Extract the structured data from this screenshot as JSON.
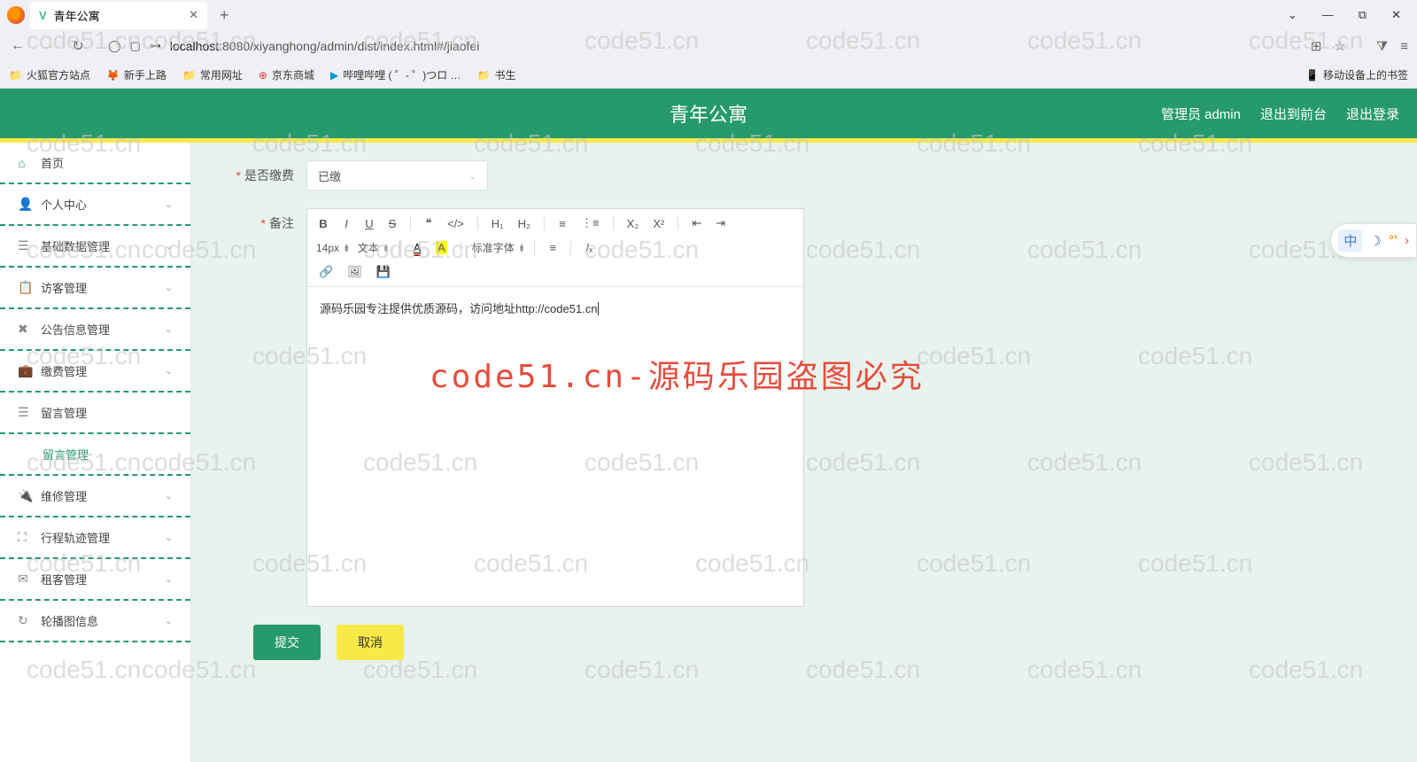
{
  "browser": {
    "tab_title": "青年公寓",
    "url_prefix": "localhost",
    "url_path": ":8080/xiyanghong/admin/dist/index.html#/jiaofei",
    "new_tab": "+",
    "win_min": "—",
    "win_max": "⧉",
    "win_close": "✕"
  },
  "bookmarks": {
    "items": [
      {
        "label": "火狐官方站点",
        "icon": "🦊"
      },
      {
        "label": "新手上路",
        "icon": "🦊"
      },
      {
        "label": "常用网址",
        "icon": "📁"
      },
      {
        "label": "京东商城",
        "icon": "⊕"
      },
      {
        "label": "哔哩哔哩 ( ゜- ゜)つロ …",
        "icon": "▶"
      },
      {
        "label": "书生",
        "icon": "📁"
      }
    ],
    "right": "移动设备上的书签"
  },
  "header": {
    "title": "青年公寓",
    "admin": "管理员 admin",
    "back": "退出到前台",
    "logout": "退出登录"
  },
  "sidebar": {
    "items": [
      {
        "icon": "⌂",
        "label": "首页"
      },
      {
        "icon": "👤",
        "label": "个人中心",
        "expandable": true
      },
      {
        "icon": "☰",
        "label": "基础数据管理",
        "expandable": true
      },
      {
        "icon": "📋",
        "label": "访客管理",
        "expandable": true
      },
      {
        "icon": "✖",
        "label": "公告信息管理",
        "expandable": true
      },
      {
        "icon": "💼",
        "label": "缴费管理",
        "expandable": true
      },
      {
        "icon": "☰",
        "label": "留言管理",
        "expanded": true
      },
      {
        "label": "留言管理",
        "sub": true
      },
      {
        "icon": "🔌",
        "label": "维修管理",
        "expandable": true
      },
      {
        "icon": "⛶",
        "label": "行程轨迹管理",
        "expandable": true
      },
      {
        "icon": "✉",
        "label": "租客管理",
        "expandable": true
      },
      {
        "icon": "↻",
        "label": "轮播图信息",
        "expandable": true
      }
    ]
  },
  "form": {
    "field_paid_label": "是否缴费",
    "field_paid_value": "已缴",
    "field_remark_label": "备注",
    "editor_content": "源码乐园专注提供优质源码，访问地址http://code51.cn",
    "submit": "提交",
    "cancel": "取消"
  },
  "toolbar": {
    "fontsize": "14px",
    "style": "文本",
    "fontfamily": "标准字体"
  },
  "watermark": {
    "text": "code51.cn",
    "big": "code51.cn-源码乐园盗图必究"
  },
  "side_widget": {
    "cn": "中"
  }
}
